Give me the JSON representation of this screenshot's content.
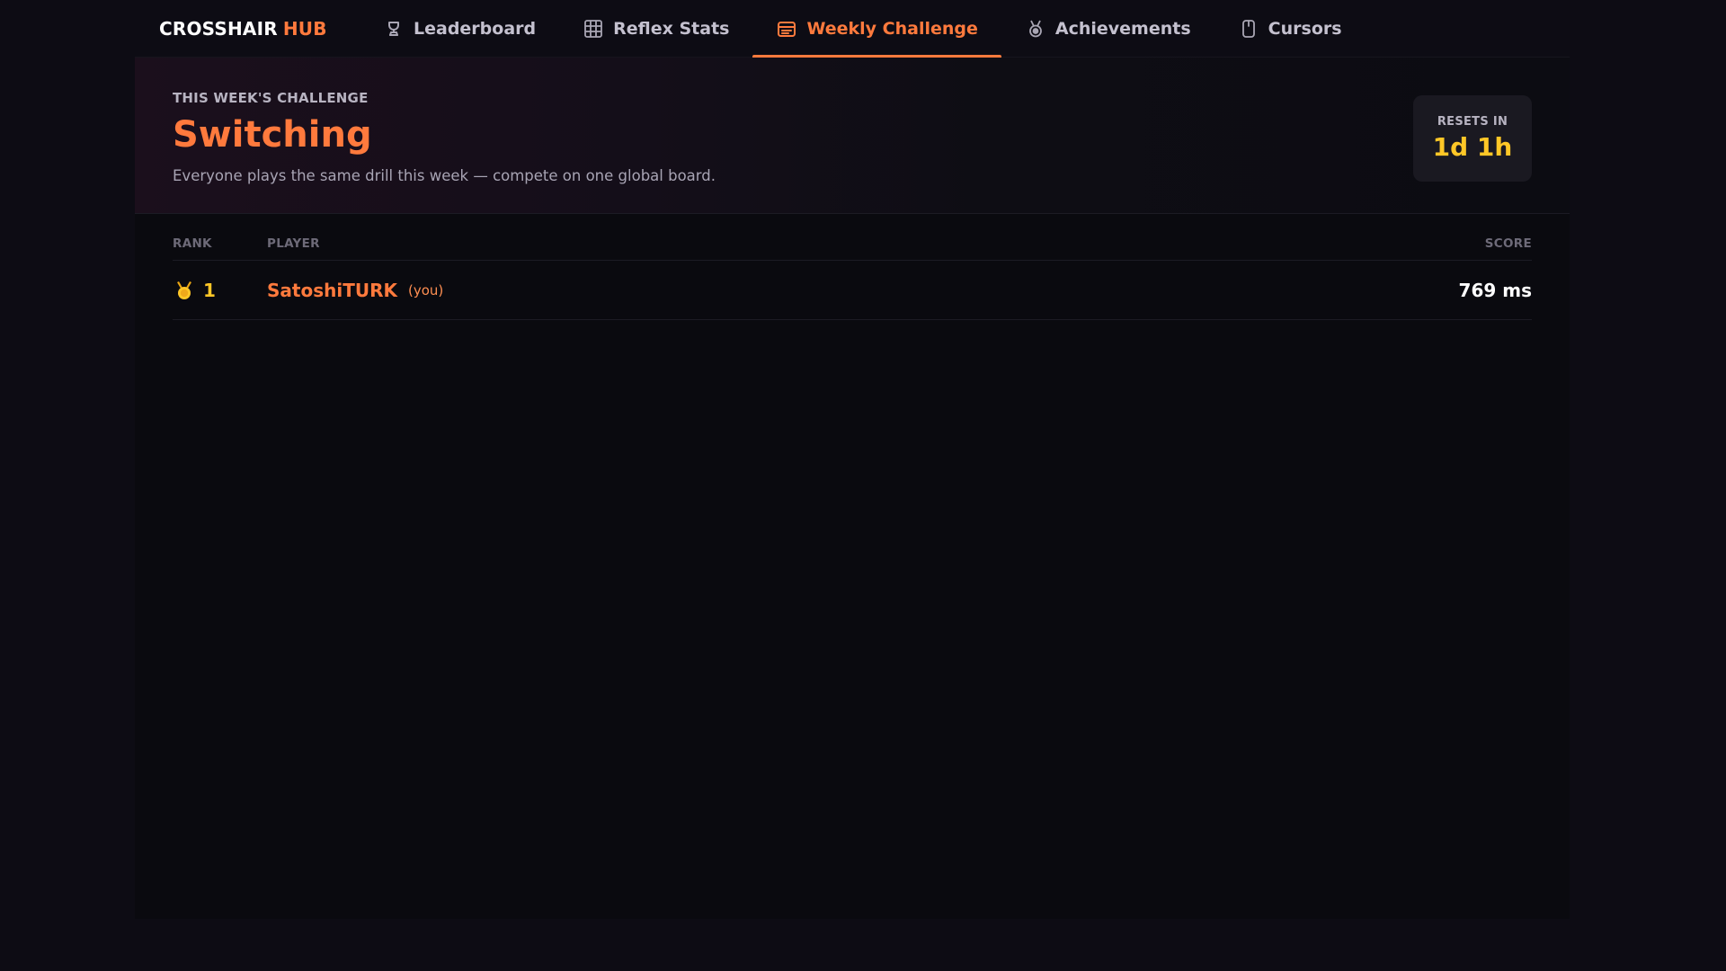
{
  "app": {
    "brand_primary": "CROSSHAIR",
    "brand_secondary": "HUB"
  },
  "nav": {
    "tabs": [
      {
        "label": "Leaderboard",
        "icon": "trophy-icon",
        "active": false
      },
      {
        "label": "Reflex Stats",
        "icon": "stats-grid-icon",
        "active": false
      },
      {
        "label": "Weekly Challenge",
        "icon": "calendar-icon",
        "active": true
      },
      {
        "label": "Achievements",
        "icon": "medal-icon",
        "active": false
      },
      {
        "label": "Cursors",
        "icon": "mouse-icon",
        "active": false
      }
    ]
  },
  "challenge": {
    "label": "THIS WEEK'S CHALLENGE",
    "title": "Switching",
    "description": "Everyone plays the same drill this week — compete on one global board.",
    "reset_label": "RESETS IN",
    "reset_value": "1d 1h"
  },
  "leaderboard": {
    "headers": {
      "rank": "RANK",
      "player": "PLAYER",
      "score": "SCORE"
    },
    "rows": [
      {
        "rank": "1",
        "player": "SatoshiTURK",
        "tag": "(you)",
        "score": "769 ms",
        "medal": "gold-medal-icon"
      }
    ]
  },
  "colors": {
    "accent": "#ff7a3d",
    "gold": "#ffc727",
    "background": "#0a0a0f"
  }
}
